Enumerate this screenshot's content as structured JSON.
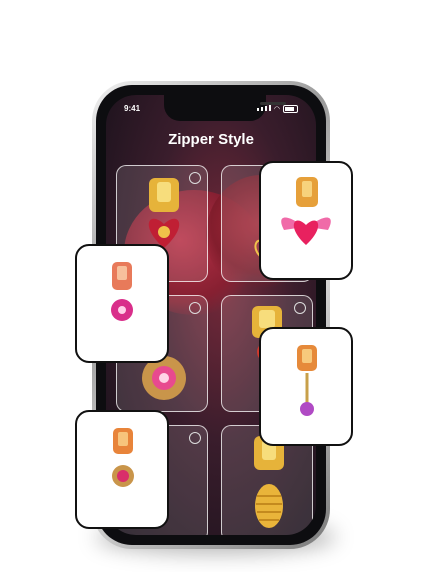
{
  "status_bar": {
    "time": "9:41"
  },
  "screen": {
    "title": "Zipper Style"
  },
  "grid": {
    "tiles": [
      "tile-1",
      "tile-2",
      "tile-3",
      "tile-4",
      "tile-5",
      "tile-6"
    ]
  },
  "colors": {
    "gold": "#e6b33a",
    "pink": "#e84a8f",
    "dark_bg": "#151019",
    "card_border": "#111111"
  }
}
